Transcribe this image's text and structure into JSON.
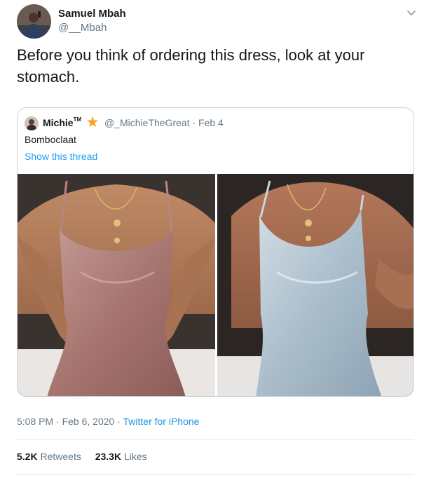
{
  "author": {
    "name": "Samuel Mbah",
    "handle": "@__Mbah"
  },
  "tweet_text": "Before you think of ordering this dress, look at your stomach.",
  "quoted": {
    "name": "Michie",
    "name_suffix": "TM",
    "badge_icon": "star-icon",
    "meta": "@_MichieTheGreat · Feb 4",
    "text": "Bomboclaat",
    "show_thread": "Show this thread",
    "photos": [
      {
        "subject": "pink-satin-dress-photo",
        "color": "#b08480"
      },
      {
        "subject": "light-blue-satin-dress-photo",
        "color": "#a9bccb"
      }
    ]
  },
  "timestamp": {
    "time": "5:08 PM · Feb 6, 2020 · ",
    "source": "Twitter for iPhone"
  },
  "stats": {
    "retweets_count": "5.2K",
    "retweets_label": "Retweets",
    "likes_count": "23.3K",
    "likes_label": "Likes"
  },
  "colors": {
    "link": "#1da1f2",
    "muted": "#657786",
    "border": "#ccd6dd"
  }
}
